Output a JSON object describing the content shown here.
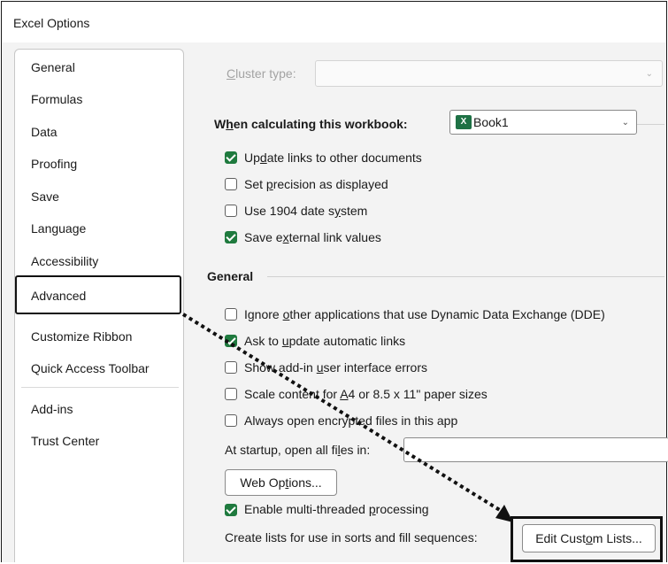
{
  "window": {
    "title": "Excel Options"
  },
  "nav": {
    "items": [
      {
        "label": "General"
      },
      {
        "label": "Formulas"
      },
      {
        "label": "Data"
      },
      {
        "label": "Proofing"
      },
      {
        "label": "Save"
      },
      {
        "label": "Language"
      },
      {
        "label": "Accessibility"
      },
      {
        "label": "Advanced",
        "selected": true
      },
      {
        "label": "Customize Ribbon"
      },
      {
        "label": "Quick Access Toolbar"
      },
      {
        "label": "Add-ins"
      },
      {
        "label": "Trust Center"
      }
    ]
  },
  "content": {
    "cluster_type": {
      "label_pre": "",
      "label_u": "C",
      "label_post": "luster type:",
      "value": ""
    },
    "workbook": {
      "label_pre": "W",
      "label_u": "h",
      "label_post": "en calculating this workbook:",
      "value": "Book1",
      "icon": "excel-icon"
    },
    "calc_options": [
      {
        "pre": "Up",
        "u": "d",
        "post": "ate links to other documents",
        "checked": true
      },
      {
        "pre": "Set ",
        "u": "p",
        "post": "recision as displayed",
        "checked": false
      },
      {
        "pre": "Use 1904 date s",
        "u": "y",
        "post": "stem",
        "checked": false
      },
      {
        "pre": "Save e",
        "u": "x",
        "post": "ternal link values",
        "checked": true
      }
    ],
    "general_section": {
      "title": "General"
    },
    "general_options": [
      {
        "pre": "Ignore ",
        "u": "o",
        "post": "ther applications that use Dynamic Data Exchange (DDE)",
        "checked": false
      },
      {
        "pre": "Ask to ",
        "u": "u",
        "post": "pdate automatic links",
        "checked": true
      },
      {
        "pre": "Show add-in ",
        "u": "u",
        "post": "ser interface errors",
        "checked": false
      },
      {
        "pre": "Scale content for ",
        "u": "A",
        "post": "4 or 8.5 x 11\" paper sizes",
        "checked": false
      },
      {
        "pre": "Always open encrypted files in this app",
        "u": "",
        "post": "",
        "checked": false
      }
    ],
    "startup": {
      "pre": "At startup, open all fi",
      "u": "l",
      "post": "es in:",
      "value": ""
    },
    "web_options": {
      "pre": "Web Op",
      "u": "t",
      "post": "ions..."
    },
    "multithread": {
      "pre": "Enable multi-threaded ",
      "u": "p",
      "post": "rocessing",
      "checked": true
    },
    "custom_lists": {
      "label": "Create lists for use in sorts and fill sequences:",
      "button_pre": "Edit Cust",
      "button_u": "o",
      "button_post": "m Lists..."
    }
  },
  "colors": {
    "check_green": "#1f7a3e",
    "excel_green": "#1e7145",
    "highlight_border": "#111111"
  }
}
